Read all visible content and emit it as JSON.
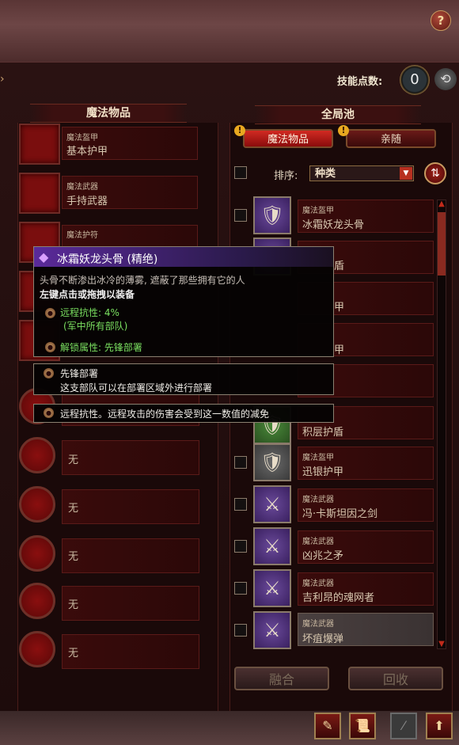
{
  "help": {
    "label": "?"
  },
  "header": {
    "skill_points_label": "技能点数:",
    "skill_points_value": "0"
  },
  "left_column": {
    "title": "魔法物品",
    "slots": [
      {
        "type": "魔法盔甲",
        "name": "基本护甲"
      },
      {
        "type": "魔法武器",
        "name": "手持武器"
      },
      {
        "type": "魔法护符",
        "name": ""
      }
    ],
    "empty_slots": [
      "无",
      "无",
      "无",
      "无",
      "无"
    ]
  },
  "right_column": {
    "title": "全局池",
    "tabs": [
      {
        "label": "魔法物品",
        "active": true
      },
      {
        "label": "亲随",
        "active": false
      }
    ],
    "sort_label": "排序:",
    "sort_value": "种类",
    "items": [
      {
        "type": "魔法盔甲",
        "name": "冰霜妖龙头骨",
        "icon": "armor-icon",
        "style": "purple"
      },
      {
        "type": "",
        "name": "盾",
        "icon": "shield-icon",
        "style": "purple"
      },
      {
        "type": "",
        "name": "甲",
        "icon": "armor-icon",
        "style": "purple"
      },
      {
        "type": "",
        "name": "甲",
        "icon": "armor-icon",
        "style": "purple"
      },
      {
        "type": "",
        "name": "",
        "icon": "armor-icon",
        "style": "purple"
      },
      {
        "type": "",
        "name": "积层护盾",
        "icon": "shield-icon",
        "style": "green"
      },
      {
        "type": "魔法盔甲",
        "name": "迅银护甲",
        "icon": "armor-icon",
        "style": "gray"
      },
      {
        "type": "魔法武器",
        "name": "冯·卡斯坦因之剑",
        "icon": "weapon-icon",
        "style": "purple"
      },
      {
        "type": "魔法武器",
        "name": "凶兆之矛",
        "icon": "weapon-icon",
        "style": "purple"
      },
      {
        "type": "魔法武器",
        "name": "吉利昂的魂网者",
        "icon": "weapon-icon",
        "style": "purple"
      },
      {
        "type": "魔法武器",
        "name": "坏疽爆弹",
        "icon": "weapon-icon",
        "style": "purple"
      }
    ]
  },
  "buttons": {
    "merge": "融合",
    "recycle": "回收"
  },
  "tooltip": {
    "title": "冰霜妖龙头骨 (精绝)",
    "description": "头骨不断渗出冰冷的薄雾, 遮蔽了那些拥有它的人",
    "hint": "左键点击或拖拽以装备",
    "effect": "远程抗性: 4%",
    "effect_scope": "(军中所有部队)",
    "unlock": "解锁属性: 先锋部署"
  },
  "tooltip_vanguard": {
    "title": "先锋部署",
    "text": "这支部队可以在部署区域外进行部署"
  },
  "tooltip_ranged": {
    "text": "远程抗性。远程攻击的伤害会受到这一数值的减免"
  }
}
